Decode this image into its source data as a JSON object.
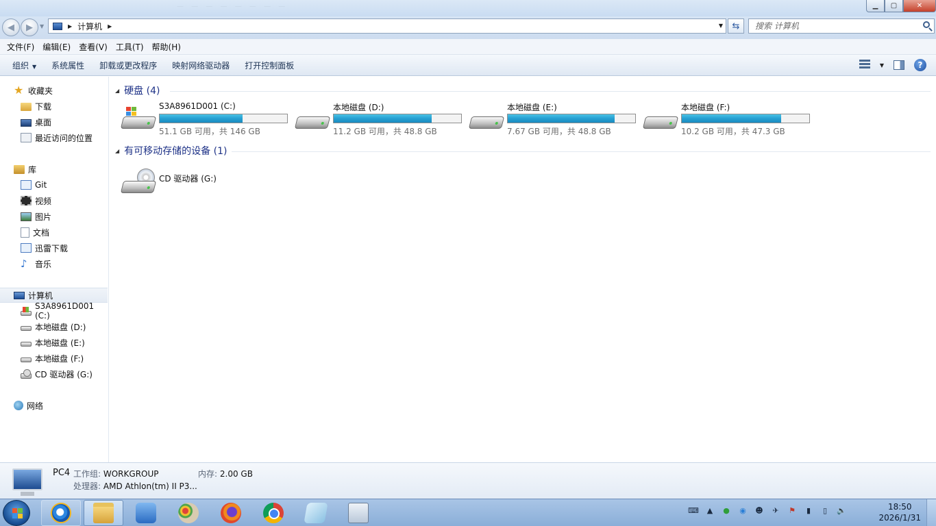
{
  "window": {
    "controls": {
      "minimize": "▁",
      "maximize": "▢",
      "close": "✕"
    }
  },
  "address": {
    "crumbs": [
      "计算机"
    ],
    "search_placeholder": "搜索 计算机"
  },
  "menubar": [
    "文件(F)",
    "编辑(E)",
    "查看(V)",
    "工具(T)",
    "帮助(H)"
  ],
  "commandbar": {
    "organize": "组织",
    "items": [
      "系统属性",
      "卸载或更改程序",
      "映射网络驱动器",
      "打开控制面板"
    ],
    "help": "?"
  },
  "navpane": {
    "favorites": {
      "label": "收藏夹",
      "items": [
        "下载",
        "桌面",
        "最近访问的位置"
      ]
    },
    "libraries": {
      "label": "库",
      "items": [
        "Git",
        "视频",
        "图片",
        "文档",
        "迅雷下载",
        "音乐"
      ]
    },
    "computer": {
      "label": "计算机",
      "items": [
        "S3A8961D001 (C:)",
        "本地磁盘 (D:)",
        "本地磁盘 (E:)",
        "本地磁盘 (F:)",
        "CD 驱动器 (G:)"
      ]
    },
    "network": {
      "label": "网络"
    }
  },
  "content": {
    "hard_disks": {
      "header": "硬盘 (4)",
      "drives": [
        {
          "name": "S3A8961D001 (C:)",
          "space": "51.1 GB 可用，共 146 GB",
          "used_fraction": 0.65
        },
        {
          "name": "本地磁盘 (D:)",
          "space": "11.2 GB 可用，共 48.8 GB",
          "used_fraction": 0.77
        },
        {
          "name": "本地磁盘 (E:)",
          "space": "7.67 GB 可用，共 48.8 GB",
          "used_fraction": 0.84
        },
        {
          "name": "本地磁盘 (F:)",
          "space": "10.2 GB 可用，共 47.3 GB",
          "used_fraction": 0.78
        }
      ]
    },
    "removable": {
      "header": "有可移动存储的设备 (1)",
      "drives": [
        {
          "name": "CD 驱动器 (G:)"
        }
      ]
    }
  },
  "details": {
    "name": "PC4",
    "workgroup_label": "工作组:",
    "workgroup": "WORKGROUP",
    "memory_label": "内存:",
    "memory": "2.00 GB",
    "processor_label": "处理器:",
    "processor": "AMD Athlon(tm) II P3..."
  },
  "taskbar": {
    "time": "18:50",
    "date": "2026/1/31"
  }
}
